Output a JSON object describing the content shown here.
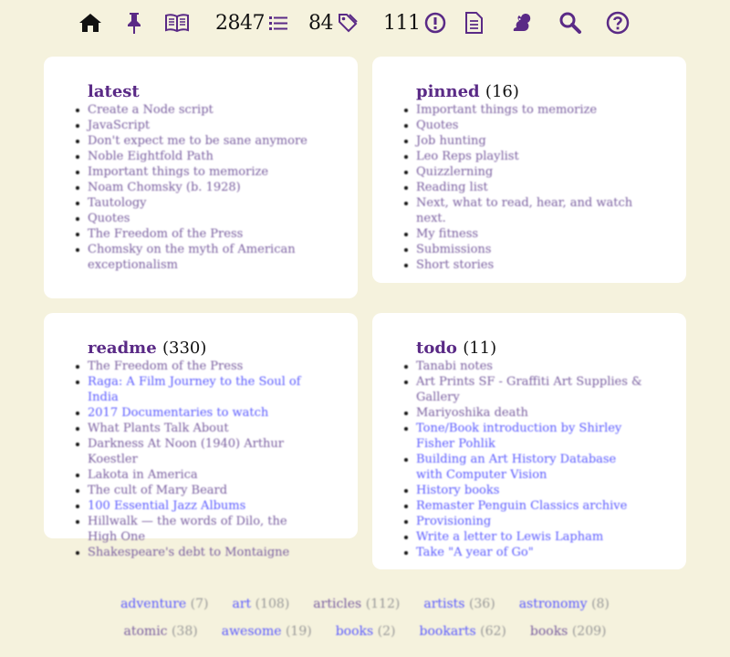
{
  "nav": {
    "counts": {
      "items": "2847",
      "tags": "84",
      "alerts": "111"
    }
  },
  "cards": {
    "latest": {
      "title": "latest",
      "count": "",
      "items": [
        {
          "text": "Create a Node script",
          "link": false
        },
        {
          "text": "JavaScript",
          "link": false
        },
        {
          "text": "Don't expect me to be sane anymore",
          "link": false
        },
        {
          "text": "Noble Eightfold Path",
          "link": false
        },
        {
          "text": "Important things to memorize",
          "link": false
        },
        {
          "text": "Noam Chomsky (b. 1928)",
          "link": false
        },
        {
          "text": "Tautology",
          "link": false
        },
        {
          "text": "Quotes",
          "link": false
        },
        {
          "text": "The Freedom of the Press",
          "link": false
        },
        {
          "text": "Chomsky on the myth of American exceptionalism",
          "link": false
        }
      ]
    },
    "pinned": {
      "title": "pinned",
      "count": "(16)",
      "items": [
        {
          "text": "Important things to memorize",
          "link": false
        },
        {
          "text": "Quotes",
          "link": false
        },
        {
          "text": "Job hunting",
          "link": false
        },
        {
          "text": "Leo Reps playlist",
          "link": false
        },
        {
          "text": "Quizzlerning",
          "link": false
        },
        {
          "text": "Reading list",
          "link": false
        },
        {
          "text": "Next, what to read, hear, and watch next.",
          "link": false
        },
        {
          "text": "My fitness",
          "link": false
        },
        {
          "text": "Submissions",
          "link": false
        },
        {
          "text": "Short stories",
          "link": false
        }
      ]
    },
    "readme": {
      "title": "readme",
      "count": "(330)",
      "items": [
        {
          "text": "The Freedom of the Press",
          "link": false
        },
        {
          "text": "Raga: A Film Journey to the Soul of India",
          "link": true
        },
        {
          "text": "2017 Documentaries to watch",
          "link": true
        },
        {
          "text": "What Plants Talk About",
          "link": false
        },
        {
          "text": "Darkness At Noon (1940) Arthur Koestler",
          "link": false
        },
        {
          "text": "Lakota in America",
          "link": false
        },
        {
          "text": "The cult of Mary Beard",
          "link": false
        },
        {
          "text": "100 Essential Jazz Albums",
          "link": true
        },
        {
          "text": "Hillwalk — the words of Dilo, the High One",
          "link": false
        },
        {
          "text": "Shakespeare's debt to Montaigne",
          "link": false
        }
      ]
    },
    "todo": {
      "title": "todo",
      "count": "(11)",
      "items": [
        {
          "text": "Tanabi notes",
          "link": false
        },
        {
          "text": "Art Prints SF - Graffiti Art Supplies & Gallery",
          "link": false
        },
        {
          "text": "Mariyoshika death",
          "link": false
        },
        {
          "text": "Tone/Book introduction by Shirley Fisher Pohlik",
          "link": true
        },
        {
          "text": "Building an Art History Database with Computer Vision",
          "link": true
        },
        {
          "text": "History books",
          "link": true
        },
        {
          "text": "Remaster Penguin Classics archive",
          "link": true
        },
        {
          "text": "Provisioning",
          "link": true
        },
        {
          "text": "Write a letter to Lewis Lapham",
          "link": true
        },
        {
          "text": "Take \"A year of Go\"",
          "link": true
        }
      ]
    }
  },
  "tags_row1": [
    {
      "name": "adventure",
      "count": "(7)",
      "color": "blue"
    },
    {
      "name": "art",
      "count": "(108)",
      "color": "blue"
    },
    {
      "name": "articles",
      "count": "(112)",
      "color": "purple"
    },
    {
      "name": "artists",
      "count": "(36)",
      "color": "blue"
    },
    {
      "name": "astronomy",
      "count": "(8)",
      "color": "blue"
    }
  ],
  "tags_row2": [
    {
      "name": "atomic",
      "count": "(38)",
      "color": "purple"
    },
    {
      "name": "awesome",
      "count": "(19)",
      "color": "blue"
    },
    {
      "name": "books",
      "count": "(2)",
      "color": "blue"
    },
    {
      "name": "bookarts",
      "count": "(62)",
      "color": "blue"
    },
    {
      "name": "books",
      "count": "(209)",
      "color": "purple"
    }
  ],
  "colors": {
    "background": "#f5f2dd",
    "accent": "#5a2a86",
    "link": "#5a5aff"
  }
}
